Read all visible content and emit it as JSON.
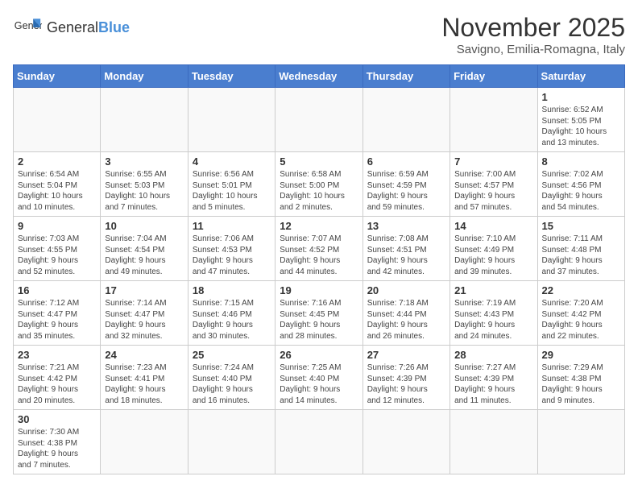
{
  "header": {
    "logo_general": "General",
    "logo_blue": "Blue",
    "month_title": "November 2025",
    "location": "Savigno, Emilia-Romagna, Italy"
  },
  "weekdays": [
    "Sunday",
    "Monday",
    "Tuesday",
    "Wednesday",
    "Thursday",
    "Friday",
    "Saturday"
  ],
  "weeks": [
    [
      {
        "day": "",
        "info": ""
      },
      {
        "day": "",
        "info": ""
      },
      {
        "day": "",
        "info": ""
      },
      {
        "day": "",
        "info": ""
      },
      {
        "day": "",
        "info": ""
      },
      {
        "day": "",
        "info": ""
      },
      {
        "day": "1",
        "info": "Sunrise: 6:52 AM\nSunset: 5:05 PM\nDaylight: 10 hours\nand 13 minutes."
      }
    ],
    [
      {
        "day": "2",
        "info": "Sunrise: 6:54 AM\nSunset: 5:04 PM\nDaylight: 10 hours\nand 10 minutes."
      },
      {
        "day": "3",
        "info": "Sunrise: 6:55 AM\nSunset: 5:03 PM\nDaylight: 10 hours\nand 7 minutes."
      },
      {
        "day": "4",
        "info": "Sunrise: 6:56 AM\nSunset: 5:01 PM\nDaylight: 10 hours\nand 5 minutes."
      },
      {
        "day": "5",
        "info": "Sunrise: 6:58 AM\nSunset: 5:00 PM\nDaylight: 10 hours\nand 2 minutes."
      },
      {
        "day": "6",
        "info": "Sunrise: 6:59 AM\nSunset: 4:59 PM\nDaylight: 9 hours\nand 59 minutes."
      },
      {
        "day": "7",
        "info": "Sunrise: 7:00 AM\nSunset: 4:57 PM\nDaylight: 9 hours\nand 57 minutes."
      },
      {
        "day": "8",
        "info": "Sunrise: 7:02 AM\nSunset: 4:56 PM\nDaylight: 9 hours\nand 54 minutes."
      }
    ],
    [
      {
        "day": "9",
        "info": "Sunrise: 7:03 AM\nSunset: 4:55 PM\nDaylight: 9 hours\nand 52 minutes."
      },
      {
        "day": "10",
        "info": "Sunrise: 7:04 AM\nSunset: 4:54 PM\nDaylight: 9 hours\nand 49 minutes."
      },
      {
        "day": "11",
        "info": "Sunrise: 7:06 AM\nSunset: 4:53 PM\nDaylight: 9 hours\nand 47 minutes."
      },
      {
        "day": "12",
        "info": "Sunrise: 7:07 AM\nSunset: 4:52 PM\nDaylight: 9 hours\nand 44 minutes."
      },
      {
        "day": "13",
        "info": "Sunrise: 7:08 AM\nSunset: 4:51 PM\nDaylight: 9 hours\nand 42 minutes."
      },
      {
        "day": "14",
        "info": "Sunrise: 7:10 AM\nSunset: 4:49 PM\nDaylight: 9 hours\nand 39 minutes."
      },
      {
        "day": "15",
        "info": "Sunrise: 7:11 AM\nSunset: 4:48 PM\nDaylight: 9 hours\nand 37 minutes."
      }
    ],
    [
      {
        "day": "16",
        "info": "Sunrise: 7:12 AM\nSunset: 4:47 PM\nDaylight: 9 hours\nand 35 minutes."
      },
      {
        "day": "17",
        "info": "Sunrise: 7:14 AM\nSunset: 4:47 PM\nDaylight: 9 hours\nand 32 minutes."
      },
      {
        "day": "18",
        "info": "Sunrise: 7:15 AM\nSunset: 4:46 PM\nDaylight: 9 hours\nand 30 minutes."
      },
      {
        "day": "19",
        "info": "Sunrise: 7:16 AM\nSunset: 4:45 PM\nDaylight: 9 hours\nand 28 minutes."
      },
      {
        "day": "20",
        "info": "Sunrise: 7:18 AM\nSunset: 4:44 PM\nDaylight: 9 hours\nand 26 minutes."
      },
      {
        "day": "21",
        "info": "Sunrise: 7:19 AM\nSunset: 4:43 PM\nDaylight: 9 hours\nand 24 minutes."
      },
      {
        "day": "22",
        "info": "Sunrise: 7:20 AM\nSunset: 4:42 PM\nDaylight: 9 hours\nand 22 minutes."
      }
    ],
    [
      {
        "day": "23",
        "info": "Sunrise: 7:21 AM\nSunset: 4:42 PM\nDaylight: 9 hours\nand 20 minutes."
      },
      {
        "day": "24",
        "info": "Sunrise: 7:23 AM\nSunset: 4:41 PM\nDaylight: 9 hours\nand 18 minutes."
      },
      {
        "day": "25",
        "info": "Sunrise: 7:24 AM\nSunset: 4:40 PM\nDaylight: 9 hours\nand 16 minutes."
      },
      {
        "day": "26",
        "info": "Sunrise: 7:25 AM\nSunset: 4:40 PM\nDaylight: 9 hours\nand 14 minutes."
      },
      {
        "day": "27",
        "info": "Sunrise: 7:26 AM\nSunset: 4:39 PM\nDaylight: 9 hours\nand 12 minutes."
      },
      {
        "day": "28",
        "info": "Sunrise: 7:27 AM\nSunset: 4:39 PM\nDaylight: 9 hours\nand 11 minutes."
      },
      {
        "day": "29",
        "info": "Sunrise: 7:29 AM\nSunset: 4:38 PM\nDaylight: 9 hours\nand 9 minutes."
      }
    ],
    [
      {
        "day": "30",
        "info": "Sunrise: 7:30 AM\nSunset: 4:38 PM\nDaylight: 9 hours\nand 7 minutes."
      },
      {
        "day": "",
        "info": ""
      },
      {
        "day": "",
        "info": ""
      },
      {
        "day": "",
        "info": ""
      },
      {
        "day": "",
        "info": ""
      },
      {
        "day": "",
        "info": ""
      },
      {
        "day": "",
        "info": ""
      }
    ]
  ]
}
